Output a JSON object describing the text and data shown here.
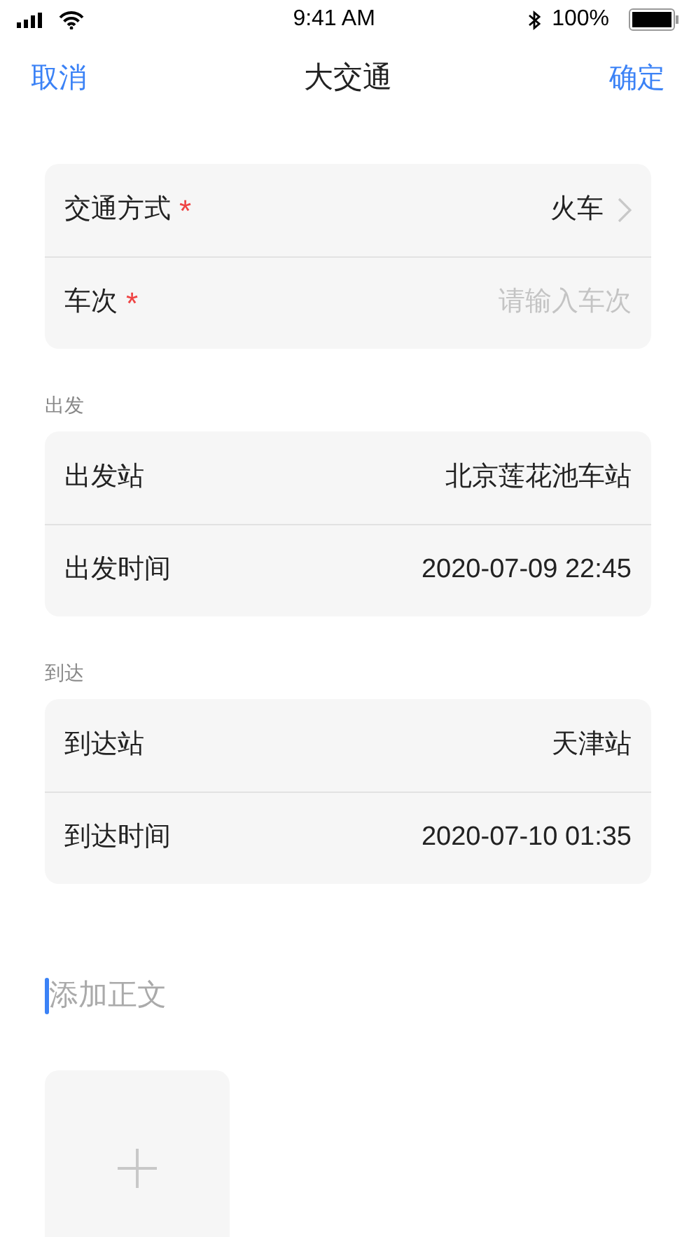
{
  "status_bar": {
    "time": "9:41 AM",
    "battery": "100%"
  },
  "nav": {
    "cancel": "取消",
    "title": "大交通",
    "confirm": "确定"
  },
  "groups": [
    {
      "rows": [
        {
          "kind": "select",
          "label": "交通方式",
          "required_mark": "*",
          "value": "火车"
        },
        {
          "kind": "input",
          "label": "车次",
          "required_mark": "*",
          "placeholder": "请输入车次"
        }
      ]
    },
    {
      "header": "出发",
      "rows": [
        {
          "kind": "value",
          "label": "出发站",
          "value": "北京莲花池车站"
        },
        {
          "kind": "value",
          "label": "出发时间",
          "value": "2020-07-09 22:45"
        }
      ]
    },
    {
      "header": "到达",
      "rows": [
        {
          "kind": "value",
          "label": "到达站",
          "value": "天津站"
        },
        {
          "kind": "value",
          "label": "到达时间",
          "value": "2020-07-10 01:35"
        }
      ]
    }
  ],
  "body_field": {
    "placeholder": "添加正文"
  }
}
